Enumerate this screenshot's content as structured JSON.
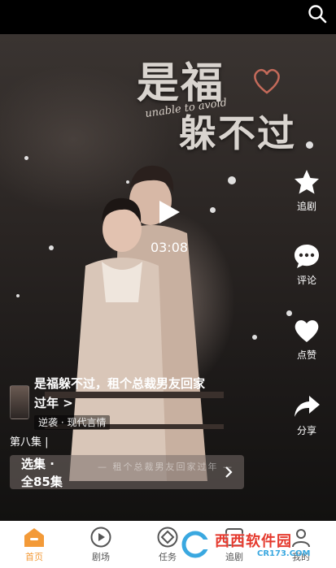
{
  "colors": {
    "accent": "#f39a38",
    "nav_bg": "#ffffff",
    "video_bg": "#2a2523"
  },
  "top": {
    "search_icon": "search-icon"
  },
  "poster": {
    "title_line1": "是福",
    "title_line2": "躲不过",
    "subtitle": "unable to avoid",
    "caption": "— 租个总裁男友回家过年 —"
  },
  "player": {
    "duration": "03:08",
    "play_icon": "play-icon"
  },
  "actions": [
    {
      "icon": "star-icon",
      "label": "追剧"
    },
    {
      "icon": "comment-icon",
      "label": "评论"
    },
    {
      "icon": "heart-icon",
      "label": "点赞"
    },
    {
      "icon": "share-icon",
      "label": "分享"
    }
  ],
  "info": {
    "title_line1": "是福躲不过，租个总裁男友回家",
    "title_line2": "过年 >",
    "tags": "逆袭 · 现代言情",
    "episode": "第八集 |",
    "select_label": "选集 ·",
    "total": "全85集"
  },
  "nav": [
    {
      "icon": "home-icon",
      "label": "首页",
      "active": true
    },
    {
      "icon": "theater-icon",
      "label": "剧场"
    },
    {
      "icon": "task-icon",
      "label": "任务"
    },
    {
      "icon": "follow-icon",
      "label": "追剧"
    },
    {
      "icon": "profile-icon",
      "label": "我的"
    }
  ],
  "watermark": {
    "text": "西西软件园",
    "url_text": "CR173.COM"
  }
}
